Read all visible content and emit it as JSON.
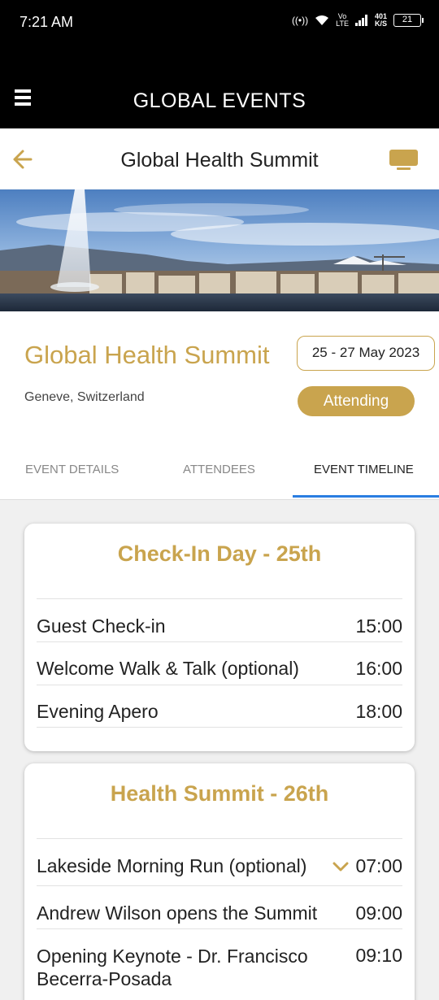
{
  "status_bar": {
    "time": "7:21 AM",
    "network_speed_value": "401",
    "network_speed_unit": "K/S",
    "network_label_top": "Vo",
    "network_label_bottom": "LTE",
    "battery": "21"
  },
  "app_bar": {
    "title": "GLOBAL EVENTS",
    "menu_icon": "hamburger-menu-icon"
  },
  "page_header": {
    "title": "Global Health Summit",
    "back_icon": "arrow-left-icon",
    "screen_icon": "tv-screen-icon"
  },
  "event": {
    "name": "Global Health Summit",
    "dates": "25 - 27 May 2023",
    "location": "Geneve, Switzerland",
    "status": "Attending"
  },
  "tabs": [
    {
      "label": "EVENT DETAILS",
      "active": false
    },
    {
      "label": "ATTENDEES",
      "active": false
    },
    {
      "label": "EVENT TIMELINE",
      "active": true
    }
  ],
  "timeline": [
    {
      "title": "Check-In Day - 25th",
      "items": [
        {
          "label": "Guest Check-in",
          "time": "15:00"
        },
        {
          "label": "Welcome Walk & Talk (optional)",
          "time": "16:00"
        },
        {
          "label": "Evening Apero",
          "time": "18:00"
        }
      ]
    },
    {
      "title": "Health Summit - 26th",
      "items": [
        {
          "label": "Lakeside Morning Run (optional)",
          "time": "07:00",
          "expandable": true
        },
        {
          "label": "Andrew Wilson opens the Summit",
          "time": "09:00"
        },
        {
          "label_line1": "Opening Keynote - Dr. Francisco",
          "label_line2": "Becerra-Posada",
          "time": "09:10"
        }
      ]
    }
  ],
  "colors": {
    "accent_gold": "#c9a44e",
    "tab_active_underline": "#2a7de1",
    "app_bar_bg": "#000000"
  }
}
